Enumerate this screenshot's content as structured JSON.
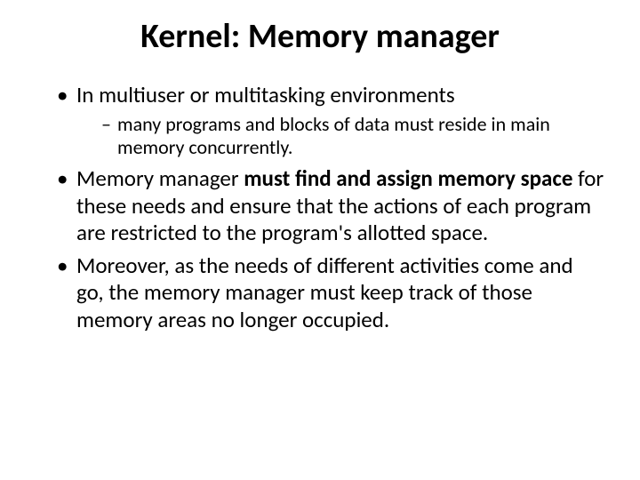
{
  "title": "Kernel: Memory manager",
  "bullets": {
    "b1": "In multiuser or multitasking environments",
    "b1_sub1": "many programs and blocks of data must reside in main memory concurrently.",
    "b2_pre": "Memory manager ",
    "b2_bold": "must find and assign memory space",
    "b2_post": " for these needs and ensure that the actions of each program are restricted to the program's allotted space.",
    "b3": "Moreover, as the needs of different activities come and go, the memory manager must keep track of those memory areas no longer occupied."
  }
}
